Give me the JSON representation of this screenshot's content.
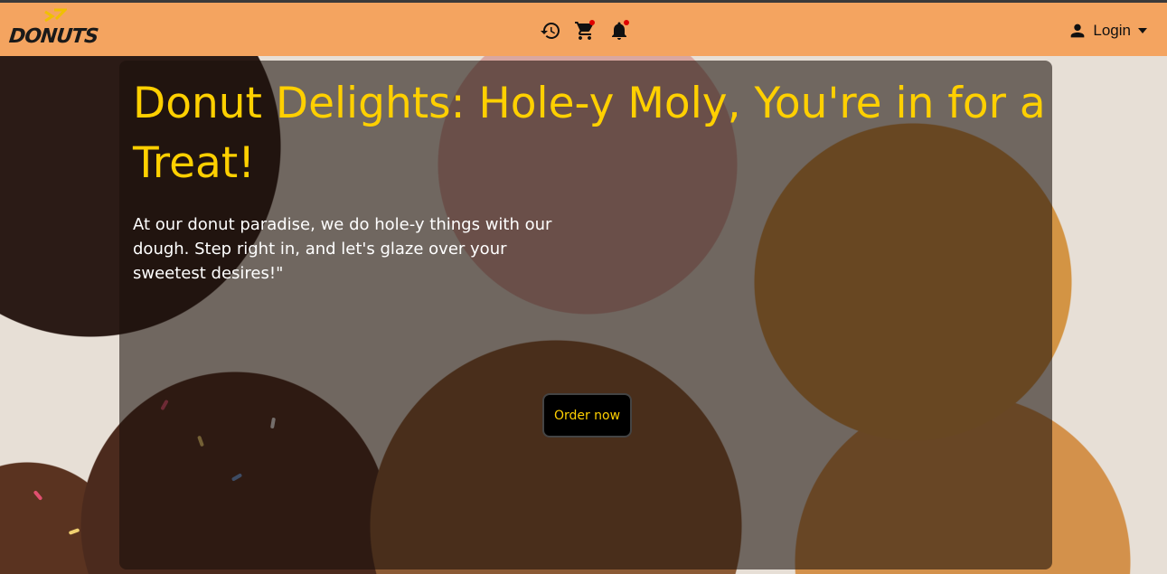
{
  "brand": {
    "logo_text": "DONUTS",
    "accent": "#f4a460",
    "title_color": "#ffd000"
  },
  "nav": {
    "icons": [
      "history-icon",
      "cart-icon",
      "bell-icon"
    ],
    "login_label": "Login"
  },
  "hero": {
    "title": "Donut Delights: Hole-y Moly, You're in for a Treat!",
    "subtitle": "At our donut paradise, we do hole-y things with our dough. Step right in, and let's glaze over your sweetest desires!\"",
    "cta_label": "Order now"
  }
}
